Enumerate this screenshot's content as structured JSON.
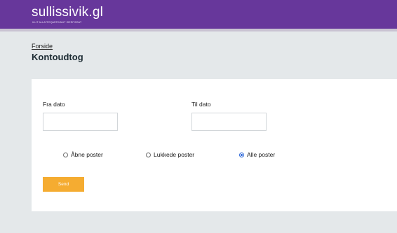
{
  "header": {
    "logo_title": "sullissivik.gl",
    "logo_subtitle": "ILLIT ALLAFFEQARFINNUT ISERFISSAT",
    "background_color": "#67379b"
  },
  "breadcrumb": {
    "home_label": "Forside"
  },
  "page": {
    "title": "Kontoudtog"
  },
  "form": {
    "from_date": {
      "label": "Fra dato",
      "value": "",
      "placeholder": ""
    },
    "to_date": {
      "label": "Til dato",
      "value": "",
      "placeholder": ""
    },
    "filter_options": [
      {
        "label": "Åbne poster",
        "selected": false
      },
      {
        "label": "Lukkede poster",
        "selected": false
      },
      {
        "label": "Alle poster",
        "selected": true
      }
    ],
    "submit_label": "Send",
    "submit_color": "#f5ac31",
    "selected_radio_color": "#2a66d9"
  }
}
